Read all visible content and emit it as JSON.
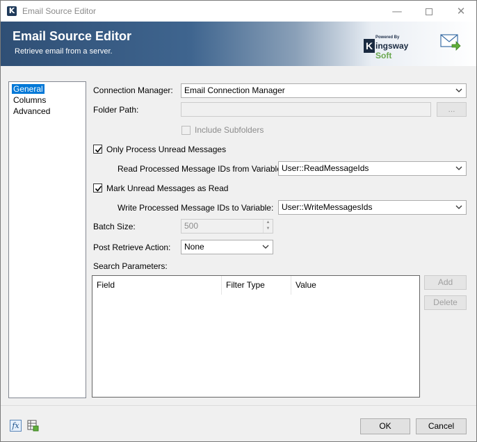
{
  "window": {
    "title": "Email Source Editor",
    "app_icon_letter": "K",
    "min_glyph": "—",
    "close_glyph": "✕"
  },
  "banner": {
    "title": "Email Source Editor",
    "subtitle": "Retrieve email from a server.",
    "brand_powered": "Powered By",
    "brand_letter": "K",
    "brand_name_a": "ingsway",
    "brand_name_b": "Soft"
  },
  "nav": {
    "items": [
      "General",
      "Columns",
      "Advanced"
    ],
    "selected": "General"
  },
  "form": {
    "connection_manager": {
      "label": "Connection Manager:",
      "value": "Email Connection Manager"
    },
    "folder_path": {
      "label": "Folder Path:",
      "value": "",
      "browse_label": "..."
    },
    "include_subfolders": {
      "label": "Include Subfolders",
      "checked": false,
      "enabled": false
    },
    "only_unread": {
      "label": "Only Process Unread Messages",
      "checked": true
    },
    "read_ids_var": {
      "label": "Read Processed Message IDs from Variable:",
      "value": "User::ReadMessageIds"
    },
    "mark_read": {
      "label": "Mark Unread Messages as Read",
      "checked": true
    },
    "write_ids_var": {
      "label": "Write Processed Message IDs to Variable:",
      "value": "User::WriteMessagesIds"
    },
    "batch_size": {
      "label": "Batch Size:",
      "value": "500"
    },
    "post_retrieve": {
      "label": "Post Retrieve Action:",
      "value": "None"
    },
    "search_params": {
      "label": "Search Parameters:",
      "columns": [
        "Field",
        "Filter Type",
        "Value"
      ],
      "rows": [],
      "add_label": "Add",
      "delete_label": "Delete"
    }
  },
  "footer": {
    "fx_label": "fx",
    "ok_label": "OK",
    "cancel_label": "Cancel"
  },
  "colors": {
    "accent": "#0078d7",
    "banner_dark": "#2f4f75",
    "brand_green": "#6aa84f"
  }
}
